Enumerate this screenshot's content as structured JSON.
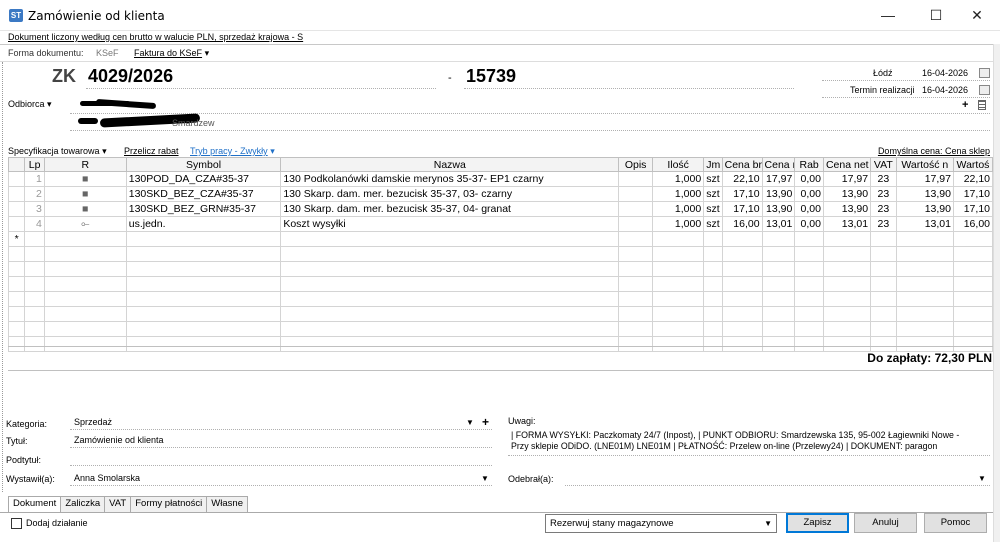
{
  "window": {
    "title": "Zamówienie od klienta",
    "app_icon": "ST",
    "minimize": "—",
    "maximize": "☐",
    "close": "✕"
  },
  "info_bar": "Dokument liczony według cen brutto w walucie PLN, sprzedaż krajowa - S",
  "form_bar": {
    "forma_label": "Forma dokumentu:",
    "ksef": "KSeF",
    "faktura": "Faktura do KSeF"
  },
  "header": {
    "doc_type": "ZK",
    "doc_number": "4029/2026",
    "dash": "-",
    "doc_number2": "15739",
    "place": "Łódź",
    "date": "16-04-2026",
    "termin_label": "Termin realizacji",
    "termin_date": "16-04-2026",
    "odbiorca_label": "Odbiorca",
    "addr_line2_suffix": "Smardzew"
  },
  "spec_bar": {
    "spec": "Specyfikacja towarowa",
    "przelicz": "Przelicz rabat",
    "tryb": "Tryb pracy - Zwykły",
    "domyslna": "Domyślna cena: Cena sklep"
  },
  "table": {
    "columns": [
      "Lp",
      "R",
      "Symbol",
      "Nazwa",
      "Opis",
      "Ilość",
      "Jm",
      "Cena bru",
      "Cena n",
      "Rab",
      "Cena net",
      "VAT",
      "Wartość n",
      "Wartoś"
    ],
    "rows": [
      {
        "lp": "1",
        "r": "■",
        "symbol": "130POD_DA_CZA#35-37",
        "nazwa": "130 Podkolanówki damskie merynos 35-37- EP1 czarny",
        "opis": "",
        "ilosc": "1,000",
        "jm": "szt",
        "cena_bru": "22,10",
        "cena_n": "17,97",
        "rab": "0,00",
        "cena_net": "17,97",
        "vat": "23",
        "wartosc_n": "17,97",
        "wartosc": "22,10"
      },
      {
        "lp": "2",
        "r": "■",
        "symbol": "130SKD_BEZ_CZA#35-37",
        "nazwa": "130 Skarp. dam. mer. bezucisk 35-37, 03- czarny",
        "opis": "",
        "ilosc": "1,000",
        "jm": "szt",
        "cena_bru": "17,10",
        "cena_n": "13,90",
        "rab": "0,00",
        "cena_net": "13,90",
        "vat": "23",
        "wartosc_n": "13,90",
        "wartosc": "17,10"
      },
      {
        "lp": "3",
        "r": "■",
        "symbol": "130SKD_BEZ_GRN#35-37",
        "nazwa": "130 Skarp. dam. mer. bezucisk 35-37, 04- granat",
        "opis": "",
        "ilosc": "1,000",
        "jm": "szt",
        "cena_bru": "17,10",
        "cena_n": "13,90",
        "rab": "0,00",
        "cena_net": "13,90",
        "vat": "23",
        "wartosc_n": "13,90",
        "wartosc": "17,10"
      },
      {
        "lp": "4",
        "r": "⟜",
        "symbol": "us.jedn.",
        "nazwa": "Koszt wysyłki",
        "opis": "",
        "ilosc": "1,000",
        "jm": "szt",
        "cena_bru": "16,00",
        "cena_n": "13,01",
        "rab": "0,00",
        "cena_net": "13,01",
        "vat": "23",
        "wartosc_n": "13,01",
        "wartosc": "16,00"
      }
    ],
    "new_row_marker": "*"
  },
  "total": "Do zapłaty: 72,30 PLN",
  "fields": {
    "kategoria_label": "Kategoria:",
    "kategoria": "Sprzedaż",
    "tytul_label": "Tytuł:",
    "tytul": "Zamówienie od klienta",
    "podtytul_label": "Podtytuł:",
    "wystawil_label": "Wystawił(a):",
    "wystawil": "Anna Smolarska",
    "uwagi_label": "Uwagi:",
    "uwagi_line1": "| FORMA WYSYŁKI: Paczkomaty 24/7 (Inpost),  | PUNKT ODBIORU: Smardzewska 135, 95-002 Łagiewniki Nowe -",
    "uwagi_line2": "Przy sklepie ODiDO.  (LNE01M)  LNE01M  | PŁATNOŚĆ: Przelew on-line (Przelewy24)  | DOKUMENT: paragon",
    "odebral_label": "Odebrał(a):"
  },
  "tabs": [
    "Dokument",
    "Zaliczka",
    "VAT",
    "Formy płatności",
    "Własne"
  ],
  "footer": {
    "dodaj": "Dodaj działanie",
    "select": "Rezerwuj stany magazynowe",
    "zapisz": "Zapisz",
    "anuluj": "Anuluj",
    "pomoc": "Pomoc"
  }
}
